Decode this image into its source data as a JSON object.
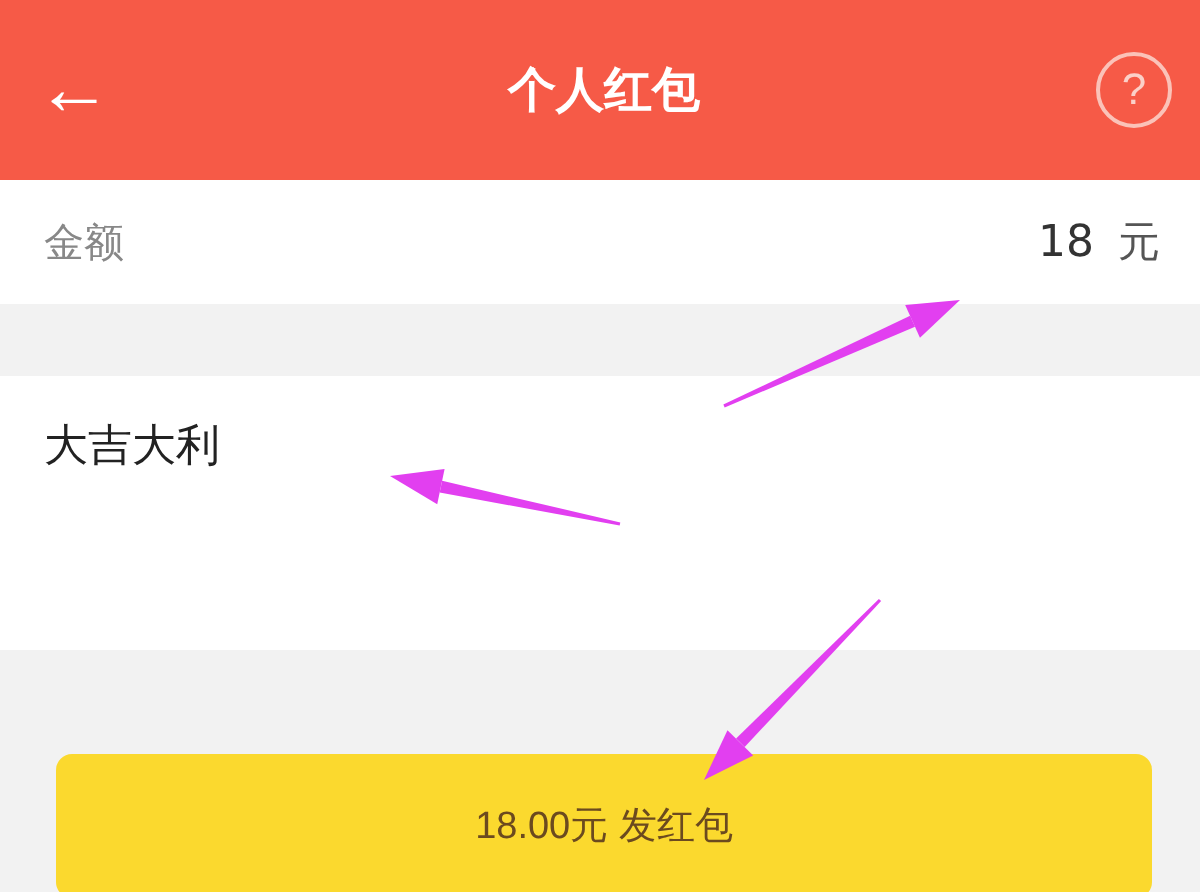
{
  "header": {
    "back_icon": "←",
    "title": "个人红包",
    "help": "?"
  },
  "amount": {
    "label": "金额",
    "value": "18",
    "unit": "元"
  },
  "message": {
    "value": "大吉大利"
  },
  "send_button": {
    "label": "18.00元 发红包"
  },
  "annotations": [
    {
      "kind": "arrow"
    },
    {
      "kind": "arrow"
    },
    {
      "kind": "arrow"
    }
  ]
}
